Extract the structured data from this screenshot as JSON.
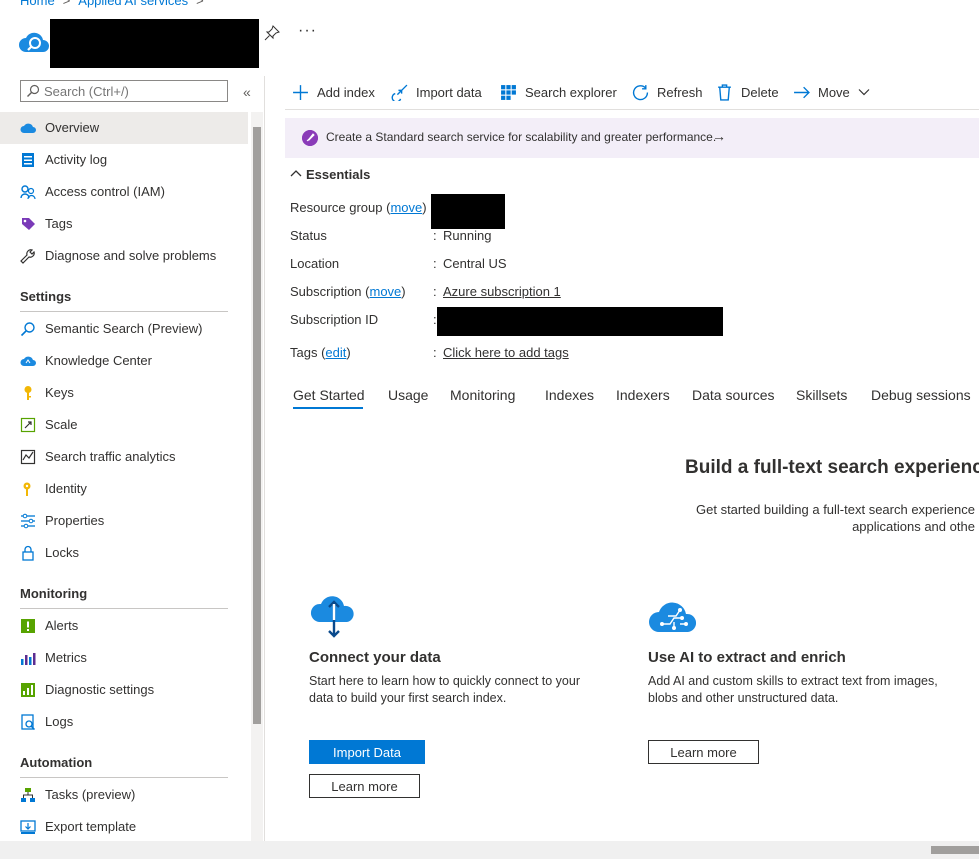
{
  "breadcrumb": {
    "items": [
      "Home",
      "Applied AI services"
    ]
  },
  "header": {
    "more_label": "···"
  },
  "sidebar": {
    "search_placeholder": "Search (Ctrl+/)",
    "collapse_label": "«",
    "top_items": [
      {
        "label": "Overview",
        "icon": "cloud-search-icon"
      },
      {
        "label": "Activity log",
        "icon": "activity-log-icon"
      },
      {
        "label": "Access control (IAM)",
        "icon": "people-icon"
      },
      {
        "label": "Tags",
        "icon": "tag-icon"
      },
      {
        "label": "Diagnose and solve problems",
        "icon": "wrench-icon"
      }
    ],
    "sections": [
      {
        "title": "Settings",
        "items": [
          {
            "label": "Semantic Search (Preview)",
            "icon": "search-icon"
          },
          {
            "label": "Knowledge Center",
            "icon": "cloud-icon"
          },
          {
            "label": "Keys",
            "icon": "key-icon"
          },
          {
            "label": "Scale",
            "icon": "scale-icon"
          },
          {
            "label": "Search traffic analytics",
            "icon": "chart-icon"
          },
          {
            "label": "Identity",
            "icon": "identity-icon"
          },
          {
            "label": "Properties",
            "icon": "properties-icon"
          },
          {
            "label": "Locks",
            "icon": "lock-icon"
          }
        ]
      },
      {
        "title": "Monitoring",
        "items": [
          {
            "label": "Alerts",
            "icon": "alert-icon"
          },
          {
            "label": "Metrics",
            "icon": "metrics-icon"
          },
          {
            "label": "Diagnostic settings",
            "icon": "diagnostic-icon"
          },
          {
            "label": "Logs",
            "icon": "logs-icon"
          }
        ]
      },
      {
        "title": "Automation",
        "items": [
          {
            "label": "Tasks (preview)",
            "icon": "tasks-icon"
          },
          {
            "label": "Export template",
            "icon": "export-icon"
          }
        ]
      }
    ]
  },
  "toolbar": {
    "add_index": "Add index",
    "import_data": "Import data",
    "search_explorer": "Search explorer",
    "refresh": "Refresh",
    "delete": "Delete",
    "move": "Move"
  },
  "banner": {
    "text": "Create a Standard search service for scalability and greater performance.",
    "arrow": "→"
  },
  "essentials": {
    "heading": "Essentials",
    "rows": {
      "resource_group": {
        "label": "Resource group",
        "link": "move"
      },
      "status": {
        "label": "Status",
        "value": "Running"
      },
      "location": {
        "label": "Location",
        "value": "Central US"
      },
      "subscription": {
        "label": "Subscription",
        "link": "move",
        "value": "Azure subscription 1"
      },
      "subscription_id": {
        "label": "Subscription ID"
      },
      "tags": {
        "label": "Tags",
        "link": "edit",
        "value": "Click here to add tags"
      }
    }
  },
  "tabs": [
    "Get Started",
    "Usage",
    "Monitoring",
    "Indexes",
    "Indexers",
    "Data sources",
    "Skillsets",
    "Debug sessions"
  ],
  "get_started": {
    "title": "Build a full-text search experienc",
    "subtitle_line1": "Get started building a full-text search experience",
    "subtitle_line2": "applications and othe"
  },
  "cards": [
    {
      "title": "Connect your data",
      "desc": "Start here to learn how to quickly connect to your data to build your first search index.",
      "primary": "Import Data",
      "secondary": "Learn more"
    },
    {
      "title": "Use AI to extract and enrich",
      "desc": "Add AI and custom skills to extract text from images, blobs and other unstructured data.",
      "secondary": "Learn more"
    }
  ],
  "colors": {
    "accent": "#0078d4",
    "banner_bg": "#f3eef8",
    "active_nav": "#edebe9"
  }
}
